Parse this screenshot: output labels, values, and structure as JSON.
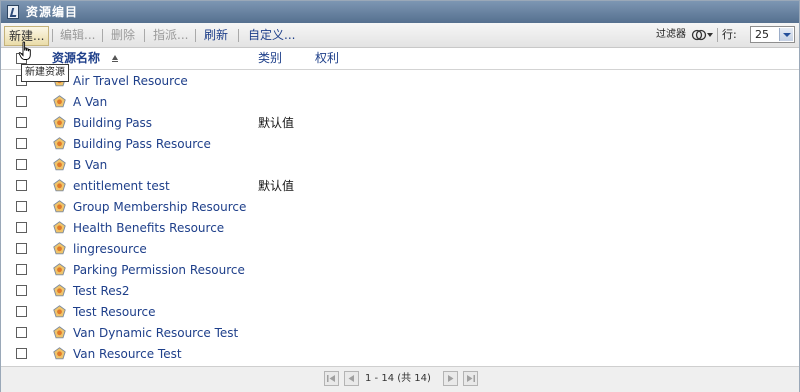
{
  "window": {
    "title": "资源编目"
  },
  "toolbar": {
    "new_label": "新建...",
    "edit_label": "编辑...",
    "delete_label": "删除",
    "assign_label": "指派...",
    "refresh_label": "刷新",
    "customize_label": "自定义...",
    "filter_label": "过滤器",
    "rows_label": "行:",
    "rows_value": "25",
    "tooltip": "新建资源"
  },
  "columns": {
    "name": "资源名称",
    "category": "类别",
    "rights": "权利"
  },
  "rows": [
    {
      "name": "Air Travel Resource",
      "category": ""
    },
    {
      "name": "A Van",
      "category": ""
    },
    {
      "name": "Building Pass",
      "category": "默认值"
    },
    {
      "name": "Building Pass Resource",
      "category": ""
    },
    {
      "name": "B Van",
      "category": ""
    },
    {
      "name": "entitlement test",
      "category": "默认值"
    },
    {
      "name": "Group Membership Resource",
      "category": ""
    },
    {
      "name": "Health Benefits Resource",
      "category": ""
    },
    {
      "name": "lingresource",
      "category": ""
    },
    {
      "name": "Parking Permission Resource",
      "category": ""
    },
    {
      "name": "Test Res2",
      "category": ""
    },
    {
      "name": "Test Resource",
      "category": ""
    },
    {
      "name": "Van Dynamic Resource Test",
      "category": ""
    },
    {
      "name": "Van Resource Test",
      "category": ""
    }
  ],
  "pager": {
    "text": "1 - 14 (共 14)"
  },
  "colors": {
    "link": "#1e3f8a",
    "titlebar": "#6a84a3",
    "accent": "#e9a13b"
  }
}
